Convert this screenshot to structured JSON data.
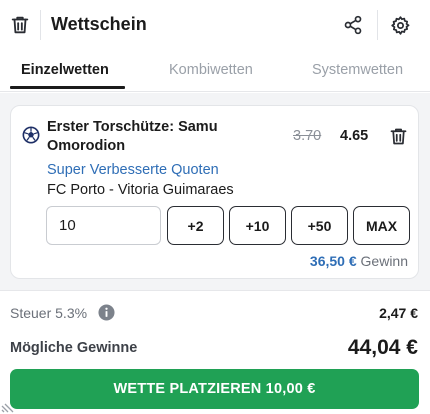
{
  "header": {
    "title": "Wettschein",
    "icons": {
      "clear": "trash-icon",
      "share": "share-icon",
      "settings": "gear-icon"
    }
  },
  "tabs": [
    {
      "label": "Einzelwetten",
      "active": true
    },
    {
      "label": "Kombiwetten",
      "active": false
    },
    {
      "label": "Systemwetten",
      "active": false
    }
  ],
  "bet": {
    "sport_icon": "soccer-ball-icon",
    "selection": "Erster Torschütze: Samu Omorodion",
    "old_odds": "3.70",
    "new_odds": "4.65",
    "promo": "Super Verbesserte Quoten",
    "match": "FC Porto - Vitoria Guimaraes",
    "stake_value": "10",
    "quick_stakes": [
      "+2",
      "+10",
      "+50",
      "MAX"
    ],
    "potential_win_amount": "36,50 €",
    "potential_win_label": "Gewinn"
  },
  "summary": {
    "tax_label": "Steuer 5.3%",
    "tax_value": "2,47 €",
    "possible_win_label": "Mögliche Gewinne",
    "possible_win_value": "44,04 €",
    "place_bet_label": "WETTE PLATZIEREN 10,00 €"
  },
  "colors": {
    "accent_green": "#20a155",
    "link_blue": "#2f6eb6",
    "panel_bg": "#f3f4f6"
  }
}
